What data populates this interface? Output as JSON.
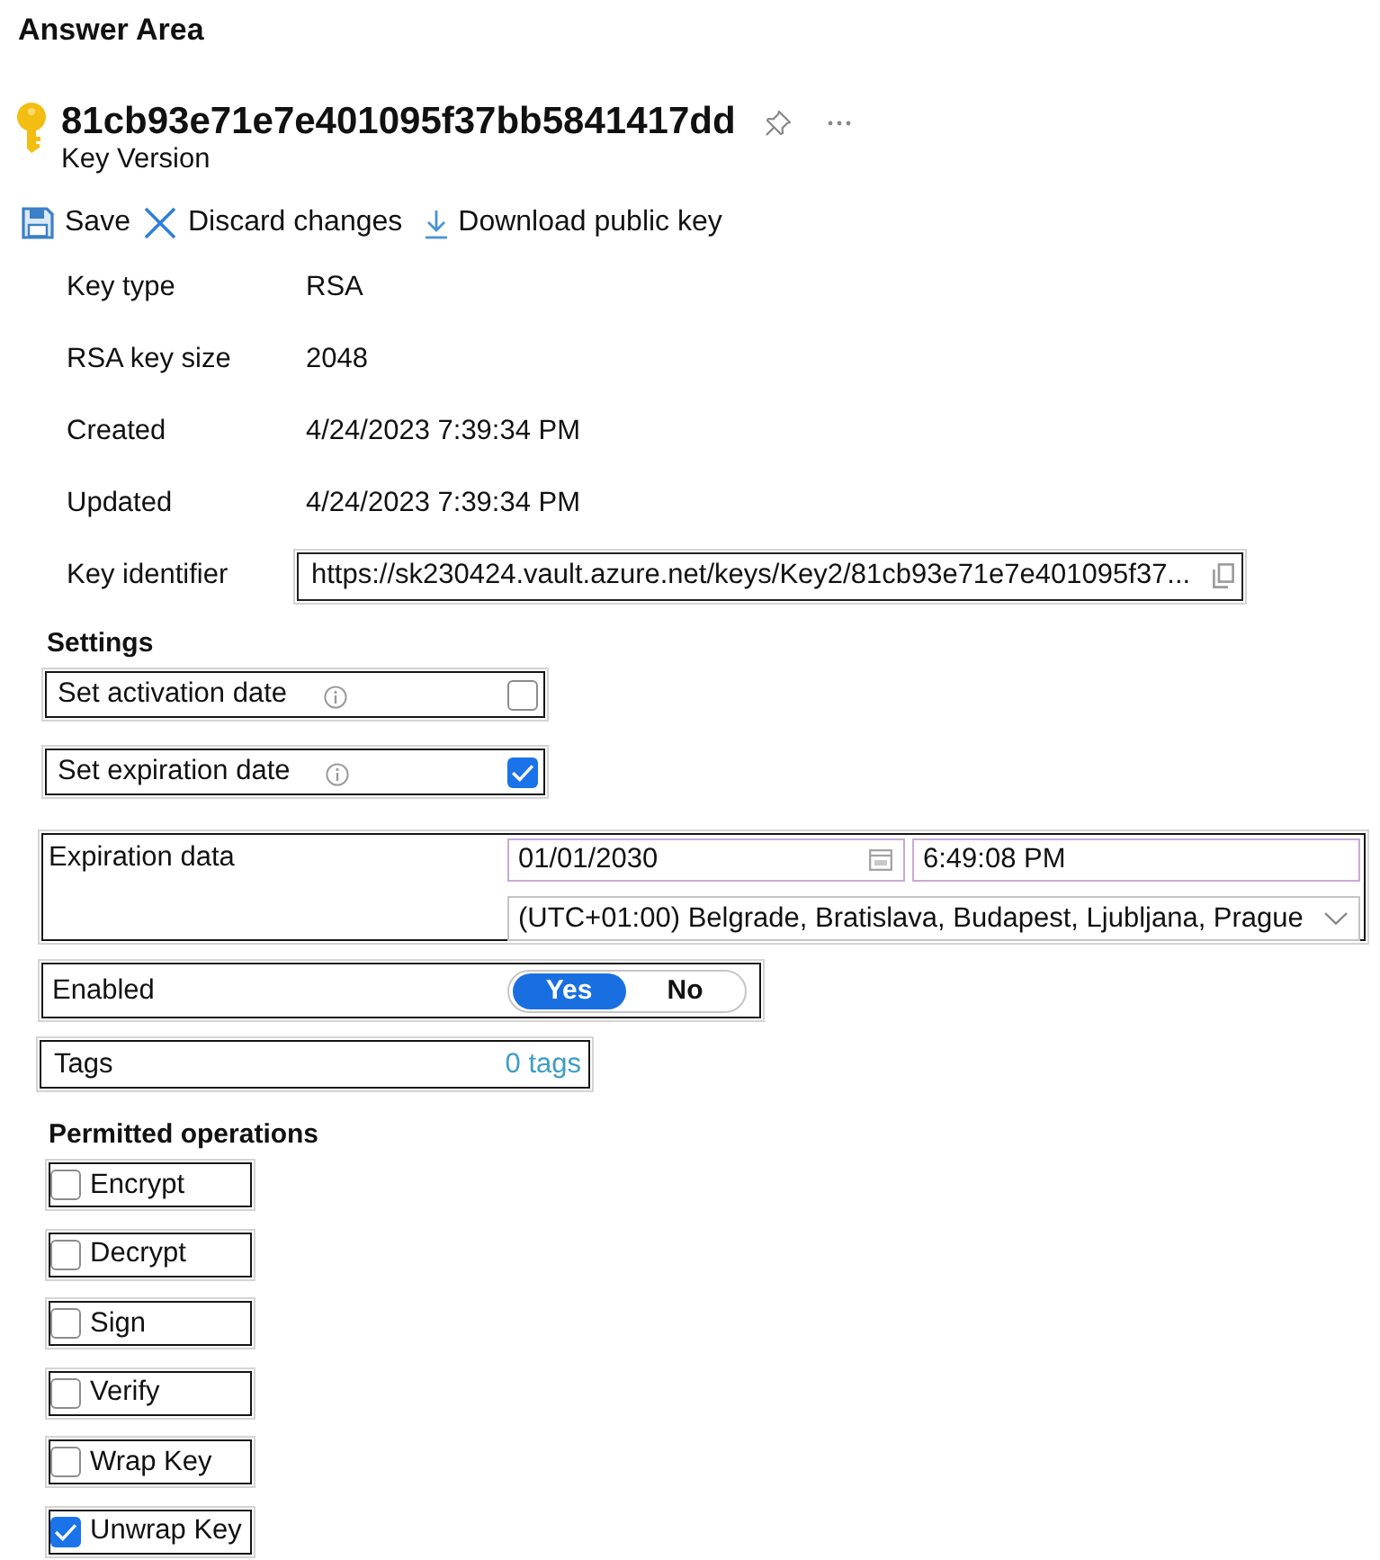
{
  "heading": "Answer Area",
  "key": {
    "title": "81cb93e71e7e401095f37bb5841417dd",
    "subtitle": "Key Version"
  },
  "toolbar": [
    {
      "kind": "save",
      "label": "Save"
    },
    {
      "kind": "discard",
      "label": "Discard changes"
    },
    {
      "kind": "download",
      "label": "Download public key"
    }
  ],
  "properties": [
    {
      "kind": "text",
      "label": "Key type",
      "value": "RSA"
    },
    {
      "kind": "text",
      "label": "RSA key size",
      "value": "2048"
    },
    {
      "kind": "text",
      "label": "Created",
      "value": "4/24/2023 7:39:34 PM"
    },
    {
      "kind": "text",
      "label": "Updated",
      "value": "4/24/2023 7:39:34 PM"
    },
    {
      "kind": "field",
      "label": "Key identifier",
      "value": "https://sk230424.vault.azure.net/keys/Key2/81cb93e71e7e401095f37..."
    }
  ],
  "settings": {
    "title": "Settings",
    "options": [
      {
        "label": "Set activation date",
        "checked": false
      },
      {
        "label": "Set expiration date",
        "checked": true
      }
    ],
    "expiration": {
      "label": "Expiration data",
      "date": "01/01/2030",
      "time": "6:49:08 PM",
      "timezone": "(UTC+01:00) Belgrade, Bratislava, Budapest, Ljubljana, Prague"
    },
    "enabled": {
      "label": "Enabled",
      "options": [
        {
          "label": "Yes",
          "selected": true
        },
        {
          "label": "No",
          "selected": false
        }
      ]
    },
    "tags": {
      "label": "Tags",
      "value": "0 tags"
    }
  },
  "permitted_operations": {
    "title": "Permitted operations",
    "items": [
      {
        "label": "Encrypt",
        "checked": false
      },
      {
        "label": "Decrypt",
        "checked": false
      },
      {
        "label": "Sign",
        "checked": false
      },
      {
        "label": "Verify",
        "checked": false
      },
      {
        "label": "Wrap Key",
        "checked": false
      },
      {
        "label": "Unwrap Key",
        "checked": true
      }
    ]
  }
}
